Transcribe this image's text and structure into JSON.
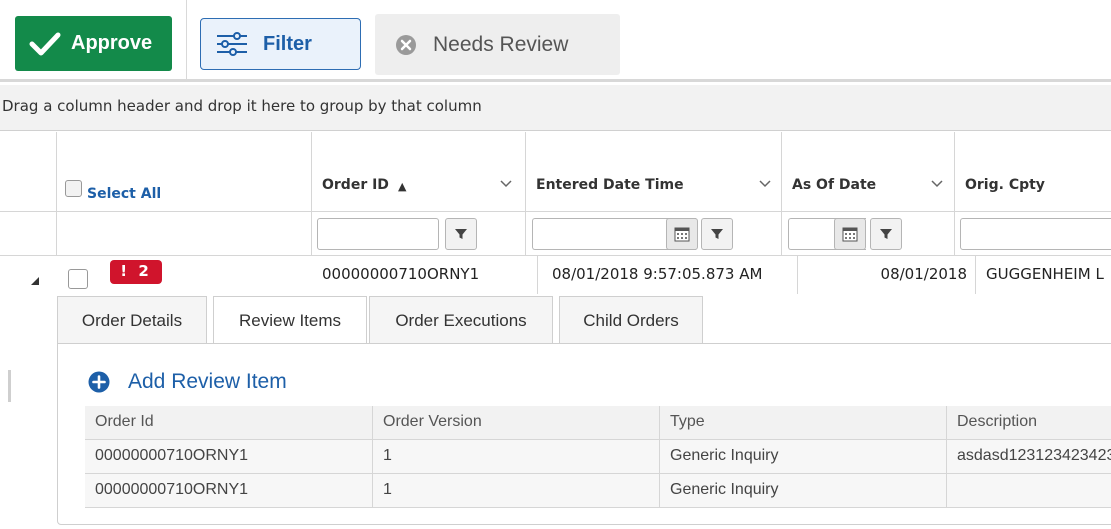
{
  "toolbar": {
    "approve_label": "Approve",
    "filter_label": "Filter",
    "needs_review_label": "Needs Review"
  },
  "group_bar": {
    "hint": "Drag a column header and drop it here to group by that column"
  },
  "grid": {
    "select_all_label": "Select All",
    "columns": [
      "Order ID",
      "Entered Date Time",
      "As Of Date",
      "Orig. Cpty"
    ],
    "sort_indicator": "▲",
    "row": {
      "alert_badge": "! 2",
      "order_id": "00000000710ORNY1",
      "entered_date_time": "08/01/2018 9:57:05.873 AM",
      "as_of_date": "08/01/2018",
      "orig_cpty": "GUGGENHEIM L"
    }
  },
  "tabs": [
    "Order Details",
    "Review Items",
    "Order Executions",
    "Child Orders"
  ],
  "active_tab": "Review Items",
  "review_panel": {
    "add_label": "Add Review Item",
    "headers": [
      "Order Id",
      "Order Version",
      "Type",
      "Description"
    ],
    "rows": [
      [
        "00000000710ORNY1",
        "1",
        "Generic Inquiry",
        "asdasd123123423423"
      ],
      [
        "00000000710ORNY1",
        "1",
        "Generic Inquiry",
        ""
      ]
    ]
  },
  "colors": {
    "approve": "#138a4a",
    "filter_border": "#2d6db3",
    "link": "#1d5fa8",
    "alert": "#d0142c"
  }
}
